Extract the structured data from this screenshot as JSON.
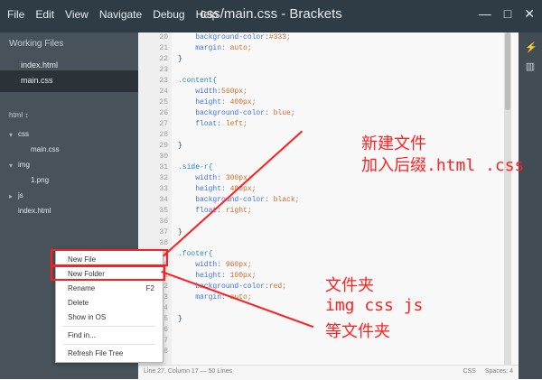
{
  "app": {
    "title": "css/main.css - Brackets",
    "menu": [
      "File",
      "Edit",
      "View",
      "Navigate",
      "Debug",
      "Help"
    ]
  },
  "sidebar": {
    "working_files_label": "Working Files",
    "working_files": [
      "index.html",
      "main.css"
    ],
    "tree_root": "html ↕",
    "tree": [
      {
        "label": "css",
        "type": "folder"
      },
      {
        "label": "main.css",
        "type": "file"
      },
      {
        "label": "img",
        "type": "folder"
      },
      {
        "label": "1.png",
        "type": "file"
      },
      {
        "label": "js",
        "type": "folder"
      },
      {
        "label": "index.html",
        "type": "file"
      }
    ]
  },
  "editor": {
    "lines": [
      {
        "n": "20",
        "text": "    background-color:#333;"
      },
      {
        "n": "21",
        "text": "    margin: auto;"
      },
      {
        "n": "22",
        "text": "}"
      },
      {
        "n": "23",
        "text": ""
      },
      {
        "n": "23",
        "text": ".content{"
      },
      {
        "n": "24",
        "text": "    width:560px;"
      },
      {
        "n": "25",
        "text": "    height: 400px;"
      },
      {
        "n": "26",
        "text": "    background-color: blue;"
      },
      {
        "n": "27",
        "text": "    float: left;"
      },
      {
        "n": "28",
        "text": ""
      },
      {
        "n": "29",
        "text": "}"
      },
      {
        "n": "30",
        "text": ""
      },
      {
        "n": "31",
        "text": ".side-r{"
      },
      {
        "n": "32",
        "text": "    width: 300px;"
      },
      {
        "n": "33",
        "text": "    height: 400px;"
      },
      {
        "n": "34",
        "text": "    background-color: black;"
      },
      {
        "n": "35",
        "text": "    float: right;"
      },
      {
        "n": "36",
        "text": ""
      },
      {
        "n": "37",
        "text": "}"
      },
      {
        "n": "38",
        "text": ""
      },
      {
        "n": "39",
        "text": ".footer{"
      },
      {
        "n": "40",
        "text": "    width: 960px;"
      },
      {
        "n": "41",
        "text": "    height: 100px;"
      },
      {
        "n": "42",
        "text": "    background-color:red;"
      },
      {
        "n": "43",
        "text": "    margin: auto;"
      },
      {
        "n": "44",
        "text": ""
      },
      {
        "n": "45",
        "text": "}"
      },
      {
        "n": "46",
        "text": ""
      },
      {
        "n": "47",
        "text": ""
      },
      {
        "n": "48",
        "text": ""
      }
    ],
    "status_left": "Line 27, Column 17 — 50 Lines",
    "status_lang": "CSS",
    "status_spaces": "Spaces: 4"
  },
  "context_menu": {
    "items": [
      {
        "label": "New File",
        "shortcut": ""
      },
      {
        "label": "New Folder",
        "shortcut": ""
      },
      {
        "label": "Rename",
        "shortcut": "F2"
      },
      {
        "label": "Delete",
        "shortcut": ""
      },
      {
        "label": "Show in OS",
        "shortcut": ""
      },
      {
        "label": "Find in...",
        "shortcut": ""
      },
      {
        "label": "Refresh File Tree",
        "shortcut": ""
      }
    ]
  },
  "annotations": {
    "new_file_1": "新建文件",
    "new_file_2": "加入后缀.html .css",
    "folder_1": "文件夹",
    "folder_2": "img   css   js",
    "folder_3": "等文件夹"
  },
  "colors": {
    "highlight": "#ff1d1d",
    "sidebar": "#47525a",
    "titlebar": "#2f3b45"
  }
}
